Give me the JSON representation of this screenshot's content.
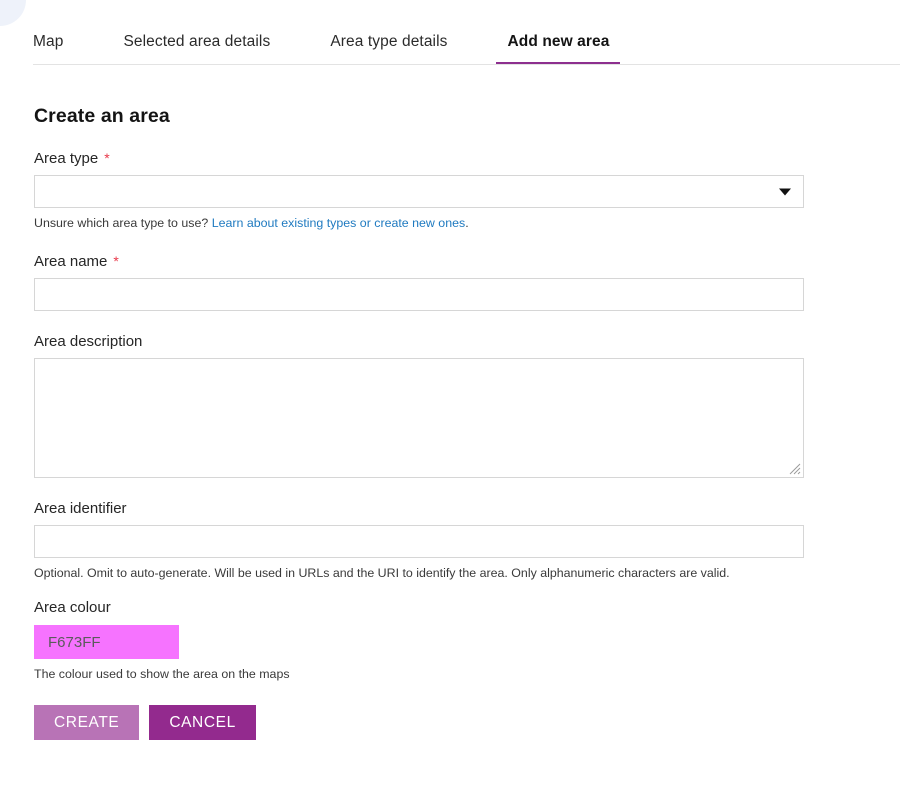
{
  "tabs": [
    {
      "label": "Map",
      "active": false
    },
    {
      "label": "Selected area details",
      "active": false
    },
    {
      "label": "Area type details",
      "active": false
    },
    {
      "label": "Add new area",
      "active": true
    }
  ],
  "page": {
    "title": "Create an area"
  },
  "fields": {
    "area_type": {
      "label": "Area type",
      "required_marker": "*",
      "value": "",
      "placeholder": "",
      "hint_text": "Unsure which area type to use? ",
      "hint_link": "Learn about existing types or create new ones",
      "hint_suffix": "."
    },
    "area_name": {
      "label": "Area name",
      "required_marker": "*",
      "value": "",
      "placeholder": ""
    },
    "area_description": {
      "label": "Area description",
      "value": "",
      "placeholder": ""
    },
    "area_identifier": {
      "label": "Area identifier",
      "value": "",
      "placeholder": "",
      "hint": "Optional. Omit to auto-generate. Will be used in URLs and the URI to identify the area. Only alphanumeric characters are valid."
    },
    "area_colour": {
      "label": "Area colour",
      "value": "F673FF",
      "swatch_hex": "#F673FF",
      "hint": "The colour used to show the area on the maps"
    }
  },
  "buttons": {
    "create": "CREATE",
    "cancel": "CANCEL"
  },
  "colors": {
    "active_tab_underline": "#8d2f8f",
    "required_star": "#e8394a",
    "link": "#1f7ac0",
    "create_button": "#b873b6",
    "cancel_button": "#932a8e",
    "area_colour_swatch": "#F673FF"
  }
}
